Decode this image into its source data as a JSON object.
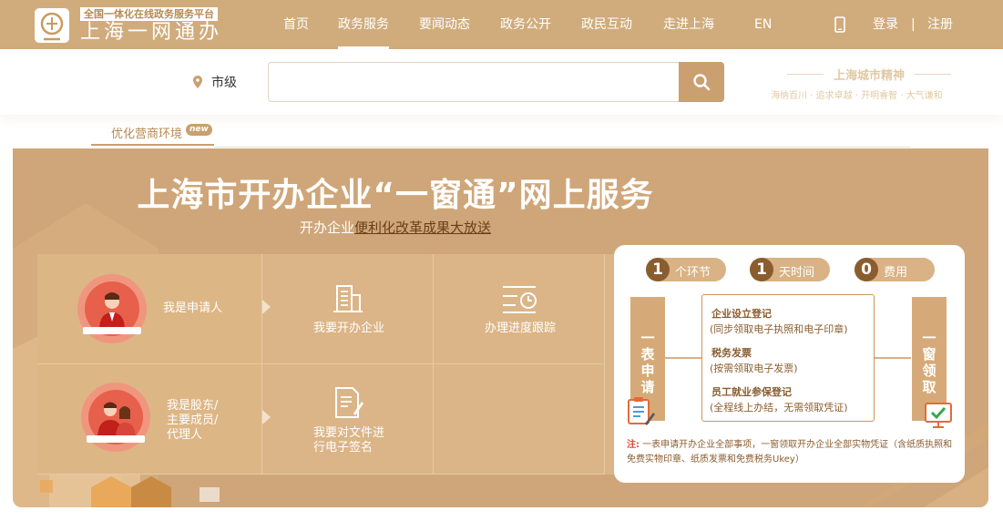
{
  "header": {
    "logo_subtitle": "全国一体化在线政务服务平台",
    "logo_title": "上海一网通办",
    "nav": [
      {
        "label": "首页",
        "active": false
      },
      {
        "label": "政务服务",
        "active": true
      },
      {
        "label": "要闻动态",
        "active": false
      },
      {
        "label": "政务公开",
        "active": false
      },
      {
        "label": "政民互动",
        "active": false
      },
      {
        "label": "走进上海",
        "active": false
      },
      {
        "label": "EN",
        "active": false
      }
    ],
    "login_label": "登录",
    "divider": "|",
    "register_label": "注册"
  },
  "search": {
    "location": "市级",
    "placeholder": "",
    "city_spirit_title": "上海城市精神",
    "city_spirit_words": "海纳百川 · 追求卓越 · 开明睿智 · 大气谦和"
  },
  "tabs": [
    {
      "label": "优化营商环境",
      "badge": "new"
    }
  ],
  "banner": {
    "title": "上海市开办企业“一窗通”网上服务",
    "subtitle_prefix": "开办企业",
    "subtitle_highlight": "便利化改革成果大放送",
    "roles": [
      {
        "label": "我是申请人"
      },
      {
        "label": "我是股东/\n主要成员/\n代理人"
      }
    ],
    "services": [
      {
        "label": "我要开办企业"
      },
      {
        "label": "办理进度跟踪"
      },
      {
        "label": "我要对文件进\n行电子签名"
      }
    ]
  },
  "info_card": {
    "steps": [
      {
        "num": "1",
        "label": "个环节"
      },
      {
        "num": "1",
        "label": "天时间"
      },
      {
        "num": "0",
        "label": "费用"
      }
    ],
    "left_pillar": "一\n表\n申\n请",
    "right_pillar": "一\n窗\n领\n取",
    "items": [
      {
        "heading": "企业设立登记",
        "detail": "(同步领取电子执照和电子印章)"
      },
      {
        "heading": "税务发票",
        "detail": "(按需领取电子发票)"
      },
      {
        "heading": "员工就业参保登记",
        "detail": "(全程线上办结，无需领取凭证)"
      }
    ],
    "note_prefix": "注:",
    "note_text": " 一表申请开办企业全部事项，一窗领取开办企业全部实物凭证（含纸质执照和免费实物印章、纸质发票和免费税务Ukey）"
  },
  "colors": {
    "header_bg": "#d0ac7c",
    "banner_bg": "#cfa679",
    "accent_dark": "#8a5d2f",
    "avatar_red": "#e7604c"
  }
}
